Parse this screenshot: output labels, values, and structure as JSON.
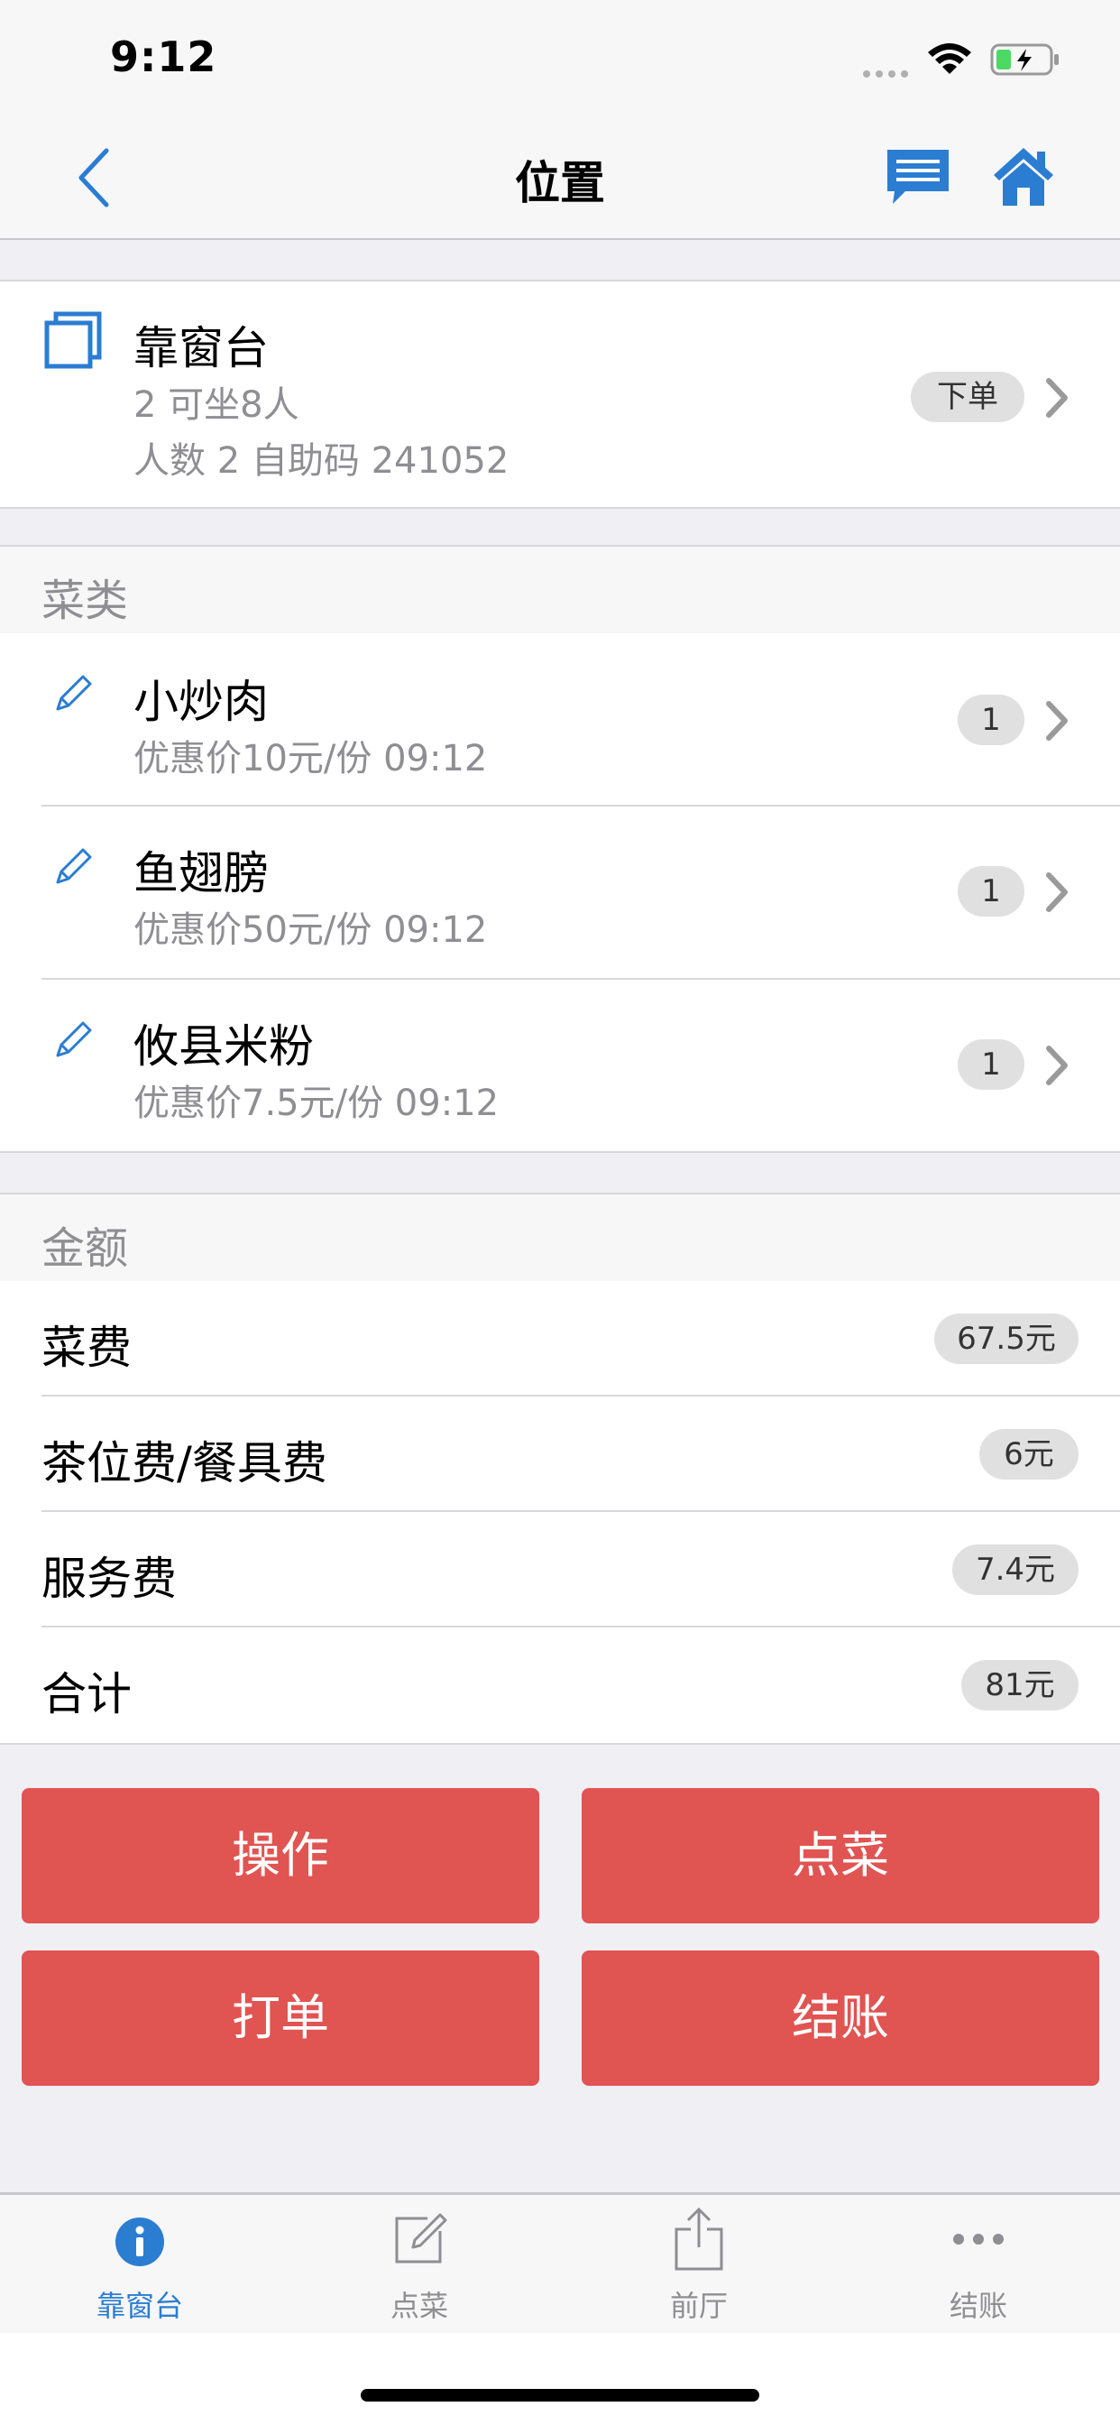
{
  "status_bar": {
    "time": "9:12"
  },
  "nav": {
    "title": "位置"
  },
  "table": {
    "name": "靠窗台",
    "capacity": "2 可坐8人",
    "info": "人数 2 自助码 241052",
    "action": "下单"
  },
  "dishes": {
    "header": "菜类",
    "items": [
      {
        "name": "小炒肉",
        "detail": "优惠价10元/份 09:12",
        "qty": "1"
      },
      {
        "name": "鱼翅膀",
        "detail": "优惠价50元/份 09:12",
        "qty": "1"
      },
      {
        "name": "攸县米粉",
        "detail": "优惠价7.5元/份 09:12",
        "qty": "1"
      }
    ]
  },
  "amount": {
    "header": "金额",
    "rows": [
      {
        "label": "菜费",
        "value": "67.5元"
      },
      {
        "label": "茶位费/餐具费",
        "value": "6元"
      },
      {
        "label": "服务费",
        "value": "7.4元"
      },
      {
        "label": "合计",
        "value": "81元"
      }
    ]
  },
  "buttons": {
    "operate": "操作",
    "order": "点菜",
    "print": "打单",
    "checkout": "结账"
  },
  "tabs": [
    {
      "label": "靠窗台",
      "icon": "info-icon",
      "active": true
    },
    {
      "label": "点菜",
      "icon": "compose-icon",
      "active": false
    },
    {
      "label": "前厅",
      "icon": "share-icon",
      "active": false
    },
    {
      "label": "结账",
      "icon": "more-icon",
      "active": false
    }
  ],
  "colors": {
    "accent": "#2b7dd1",
    "button": "#e05452",
    "pill": "#e0e0e0"
  }
}
